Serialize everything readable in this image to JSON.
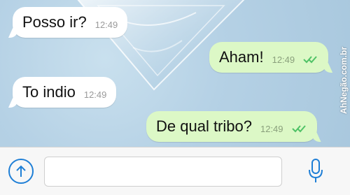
{
  "colors": {
    "incoming_bubble": "#ffffff",
    "outgoing_bubble": "#dcf8c6",
    "read_ticks": "#4fc266",
    "accent": "#1f7fd6",
    "chat_background": "#b5d1e5"
  },
  "messages": [
    {
      "direction": "incoming",
      "text": "Posso ir?",
      "time": "12:49"
    },
    {
      "direction": "outgoing",
      "text": "Aham!",
      "time": "12:49",
      "status_icon": "double-check-icon"
    },
    {
      "direction": "incoming",
      "text": "To indio",
      "time": "12:49"
    },
    {
      "direction": "outgoing",
      "text": "De qual tribo?",
      "time": "12:49",
      "status_icon": "double-check-icon"
    }
  ],
  "watermark": "AhNegão.com.br",
  "composer": {
    "attach_icon": "arrow-up-circle-icon",
    "input_value": "",
    "mic_icon": "microphone-icon"
  }
}
